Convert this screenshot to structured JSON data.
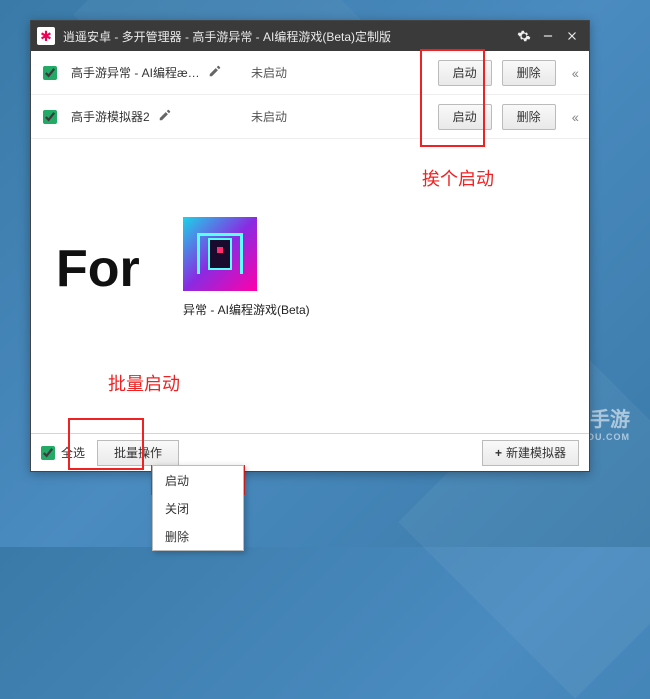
{
  "titlebar": {
    "title": "逍遥安卓 - 多开管理器 - 高手游异常 - AI编程游戏(Beta)定制版"
  },
  "rows": [
    {
      "checked": true,
      "name": "高手游异常 - AI编程æ…",
      "status": "未启动",
      "btn_launch": "启动",
      "btn_delete": "删除"
    },
    {
      "checked": true,
      "name": "高手游模拟器2",
      "status": "未启动",
      "btn_launch": "启动",
      "btn_delete": "删除"
    }
  ],
  "for_label": "For",
  "app": {
    "name": "异常 - AI编程游戏(Beta)"
  },
  "annotations": {
    "batch_start": "批量启动",
    "each_start": "挨个启动"
  },
  "bottombar": {
    "select_all": "全选",
    "batch_ops": "批量操作",
    "new_sim": "新建模拟器"
  },
  "context_menu": {
    "launch": "启动",
    "close": "关闭",
    "delete": "删除"
  },
  "watermark": {
    "brand": "高手游",
    "url": "GAOSHOUYOU.COM"
  }
}
